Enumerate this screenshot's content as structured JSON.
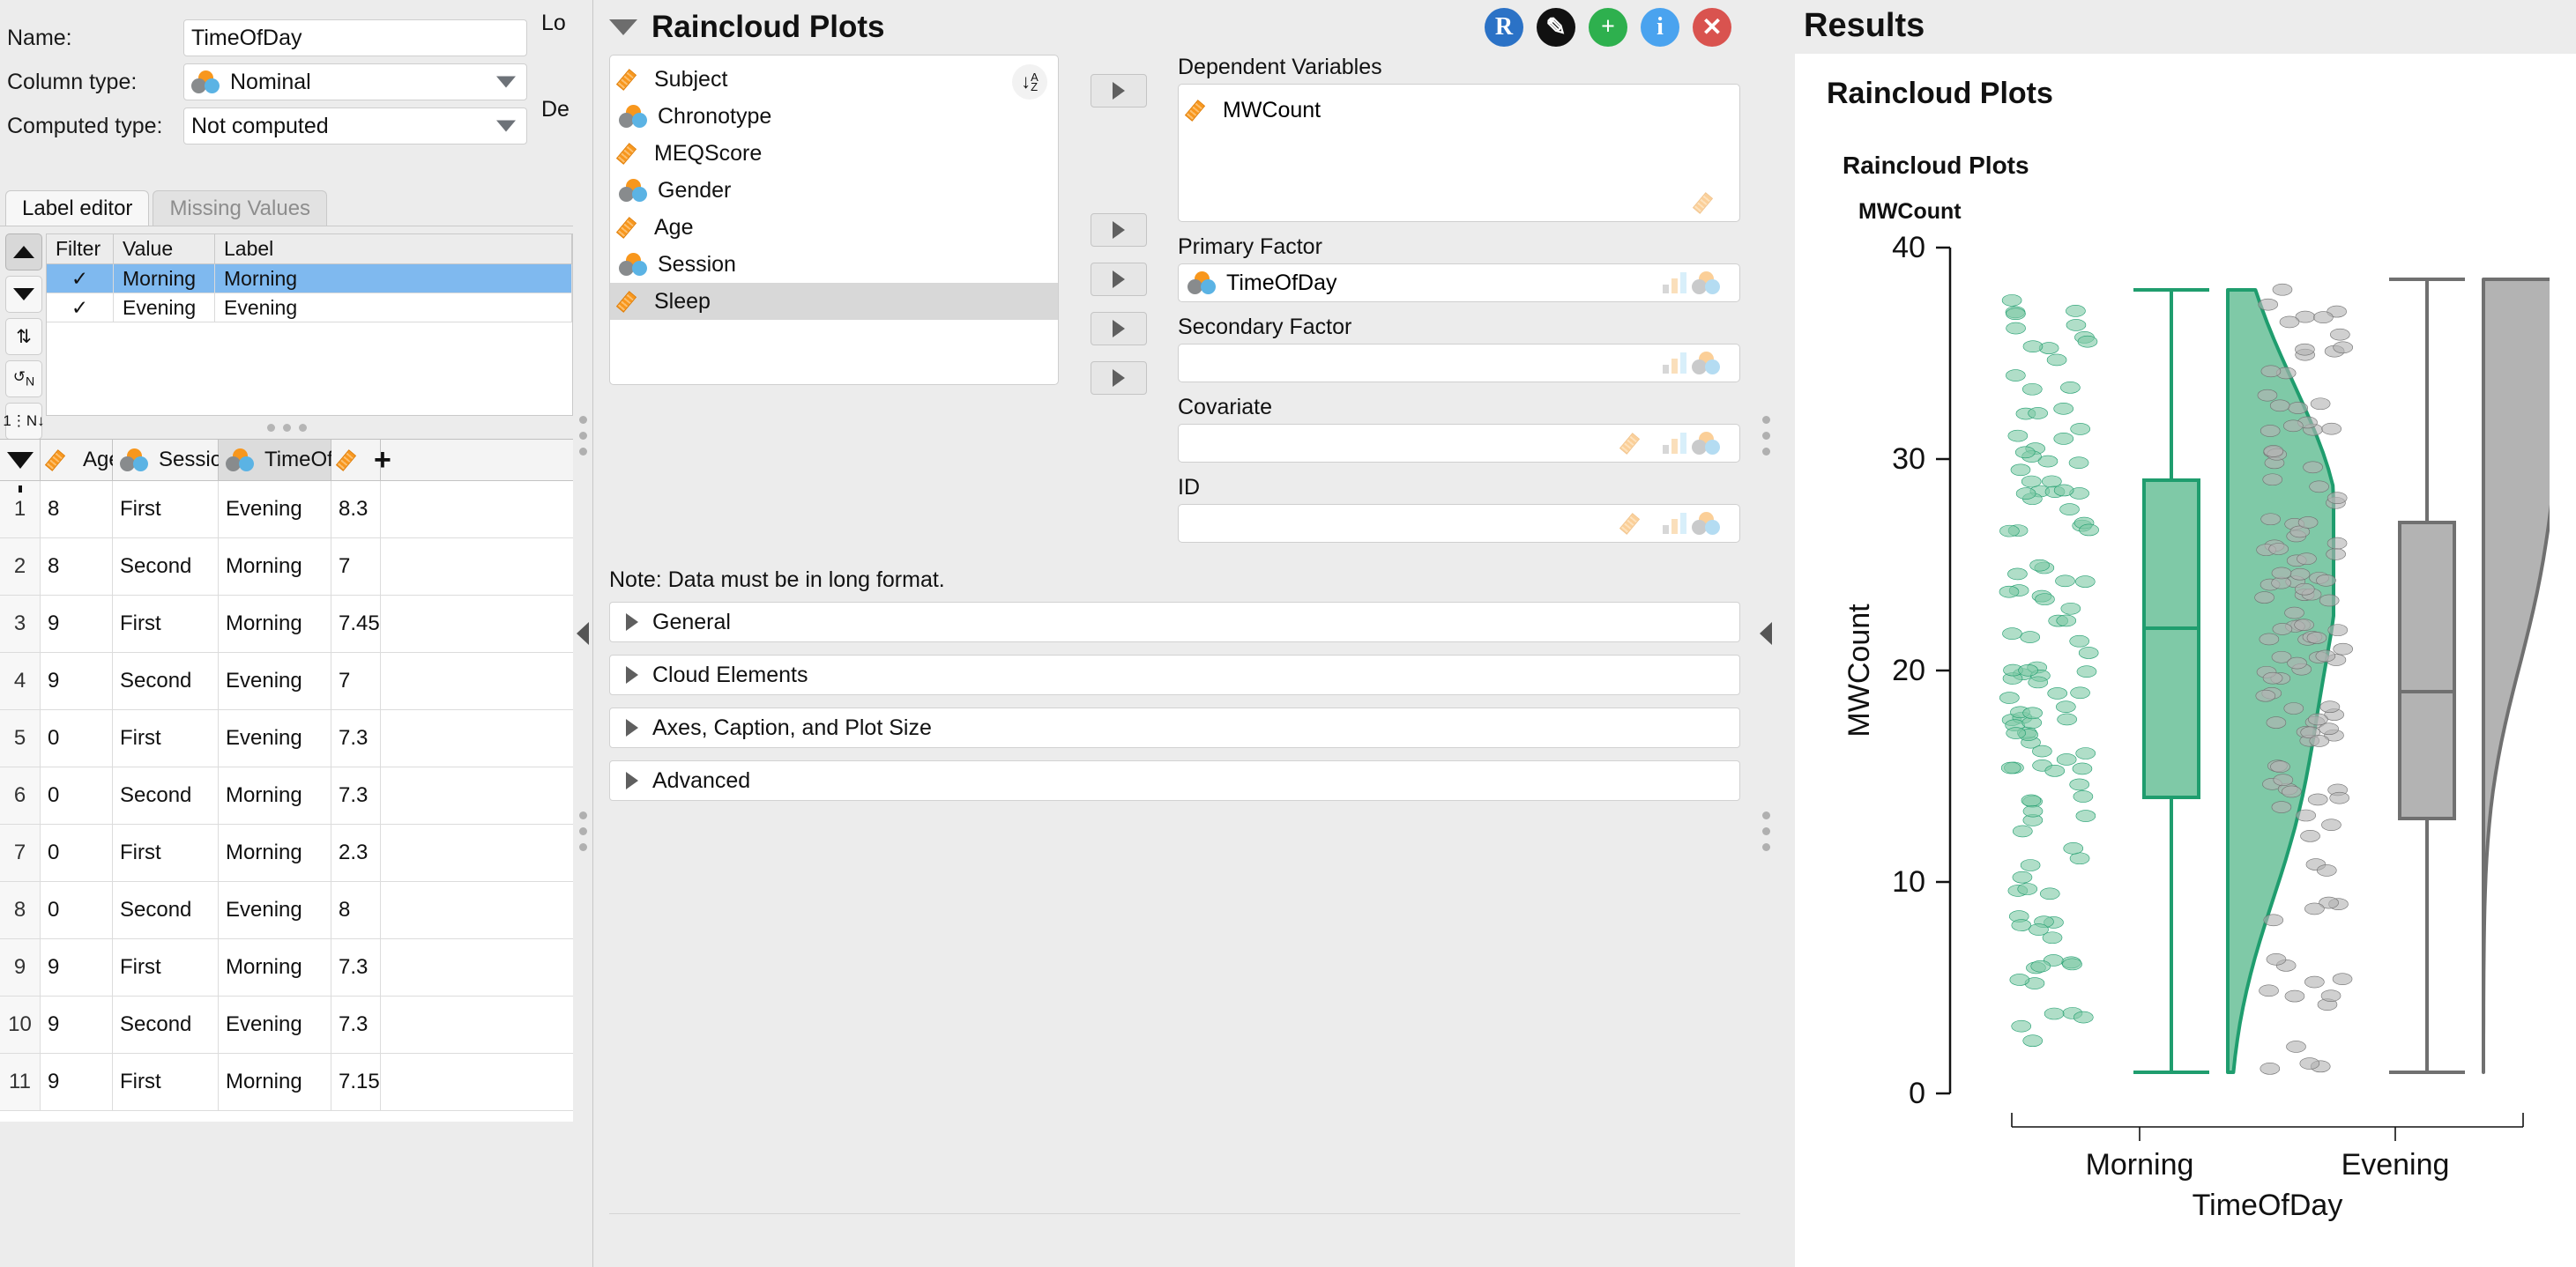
{
  "setup": {
    "name_label": "Name:",
    "name_value": "TimeOfDay",
    "coltype_label": "Column type:",
    "coltype_value": "Nominal",
    "computed_label": "Computed type:",
    "computed_value": "Not computed",
    "clipped_right_1": "Lo",
    "clipped_right_2": "De",
    "tabs": [
      {
        "label": "Label editor",
        "active": true
      },
      {
        "label": "Missing Values",
        "active": false
      }
    ],
    "side_buttons": [
      "move-up",
      "move-down",
      "swap",
      "cycle-1n",
      "sequence-1n"
    ],
    "label_table": {
      "columns": [
        "Filter",
        "Value",
        "Label"
      ],
      "rows": [
        {
          "filter": "✓",
          "value": "Morning",
          "label": "Morning",
          "selected": true
        },
        {
          "filter": "✓",
          "value": "Evening",
          "label": "Evening",
          "selected": false
        }
      ]
    }
  },
  "spreadsheet": {
    "columns": [
      {
        "name": "",
        "icon": "filter-icon",
        "type": "filter"
      },
      {
        "name": "Age",
        "icon": "ruler-icon",
        "type": "continuous"
      },
      {
        "name": "Session",
        "icon": "nominal-icon",
        "type": "nominal"
      },
      {
        "name": "TimeOfDay",
        "icon": "nominal-icon",
        "type": "nominal",
        "active": true
      },
      {
        "name": "",
        "icon": "ruler-plus-icon",
        "type": "append"
      }
    ],
    "rows": [
      {
        "n": "1",
        "age": "8",
        "session": "First",
        "timeofday": "Evening",
        "num": "8.3"
      },
      {
        "n": "2",
        "age": "8",
        "session": "Second",
        "timeofday": "Morning",
        "num": "7"
      },
      {
        "n": "3",
        "age": "9",
        "session": "First",
        "timeofday": "Morning",
        "num": "7.45"
      },
      {
        "n": "4",
        "age": "9",
        "session": "Second",
        "timeofday": "Evening",
        "num": "7"
      },
      {
        "n": "5",
        "age": "0",
        "session": "First",
        "timeofday": "Evening",
        "num": "7.3"
      },
      {
        "n": "6",
        "age": "0",
        "session": "Second",
        "timeofday": "Morning",
        "num": "7.3"
      },
      {
        "n": "7",
        "age": "0",
        "session": "First",
        "timeofday": "Morning",
        "num": "2.3"
      },
      {
        "n": "8",
        "age": "0",
        "session": "Second",
        "timeofday": "Evening",
        "num": "8"
      },
      {
        "n": "9",
        "age": "9",
        "session": "First",
        "timeofday": "Morning",
        "num": "7.3"
      },
      {
        "n": "10",
        "age": "9",
        "session": "Second",
        "timeofday": "Evening",
        "num": "7.3"
      },
      {
        "n": "11",
        "age": "9",
        "session": "First",
        "timeofday": "Morning",
        "num": "7.15"
      }
    ]
  },
  "options": {
    "title": "Raincloud Plots",
    "toolbar": [
      {
        "name": "r-syntax-button",
        "glyph": "R",
        "color": "#2b72c6"
      },
      {
        "name": "edit-button",
        "glyph": "✎",
        "color": "#111111"
      },
      {
        "name": "add-button",
        "glyph": "+",
        "color": "#2eb04e"
      },
      {
        "name": "info-button",
        "glyph": "i",
        "color": "#4aa3ef"
      },
      {
        "name": "close-button",
        "glyph": "✕",
        "color": "#d9534f"
      }
    ],
    "variables": [
      {
        "label": "Subject",
        "type": "continuous",
        "selected": false
      },
      {
        "label": "Chronotype",
        "type": "nominal",
        "selected": false
      },
      {
        "label": "MEQScore",
        "type": "continuous",
        "selected": false
      },
      {
        "label": "Gender",
        "type": "nominal",
        "selected": false
      },
      {
        "label": "Age",
        "type": "continuous",
        "selected": false
      },
      {
        "label": "Session",
        "type": "nominal",
        "selected": false
      },
      {
        "label": "Sleep",
        "type": "continuous",
        "selected": true
      }
    ],
    "sort_button": "A↓Z",
    "targets": [
      {
        "label": "Dependent Variables",
        "value": "MWCount",
        "value_type": "continuous",
        "size": "big"
      },
      {
        "label": "Primary Factor",
        "value": "TimeOfDay",
        "value_type": "nominal",
        "size": "one"
      },
      {
        "label": "Secondary Factor",
        "value": "",
        "value_type": "",
        "size": "one"
      },
      {
        "label": "Covariate",
        "value": "",
        "value_type": "",
        "size": "one"
      },
      {
        "label": "ID",
        "value": "",
        "value_type": "",
        "size": "one"
      }
    ],
    "note": "Note: Data must be in long format.",
    "sections": [
      "General",
      "Cloud Elements",
      "Axes, Caption, and Plot Size",
      "Advanced"
    ]
  },
  "results": {
    "panel_title": "Results",
    "heading": "Raincloud Plots",
    "sub_heading": "Raincloud Plots",
    "plot_title": "MWCount"
  },
  "chart_data": {
    "type": "raincloud",
    "title": "MWCount",
    "xlabel": "TimeOfDay",
    "ylabel": "MWCount",
    "ylim": [
      0,
      40
    ],
    "yticks": [
      0,
      10,
      20,
      30,
      40
    ],
    "categories": [
      "Morning",
      "Evening"
    ],
    "colors": {
      "Morning": "#35a379",
      "Evening": "#8c8c8c"
    },
    "groups": [
      {
        "name": "Morning",
        "fill": "#7fc9a7",
        "stroke": "#1f9d6e",
        "box": {
          "q1": 14.0,
          "median": 22.0,
          "q3": 29.0,
          "whisker_low": 1.0,
          "whisker_high": 38.0
        },
        "n_points": 120,
        "density_peak_at": 27.0
      },
      {
        "name": "Evening",
        "fill": "#b3b3b3",
        "stroke": "#707070",
        "box": {
          "q1": 13.0,
          "median": 19.0,
          "q3": 27.0,
          "whisker_low": 1.0,
          "whisker_high": 38.5
        },
        "n_points": 120,
        "density_peak_at": 38.0
      }
    ]
  }
}
